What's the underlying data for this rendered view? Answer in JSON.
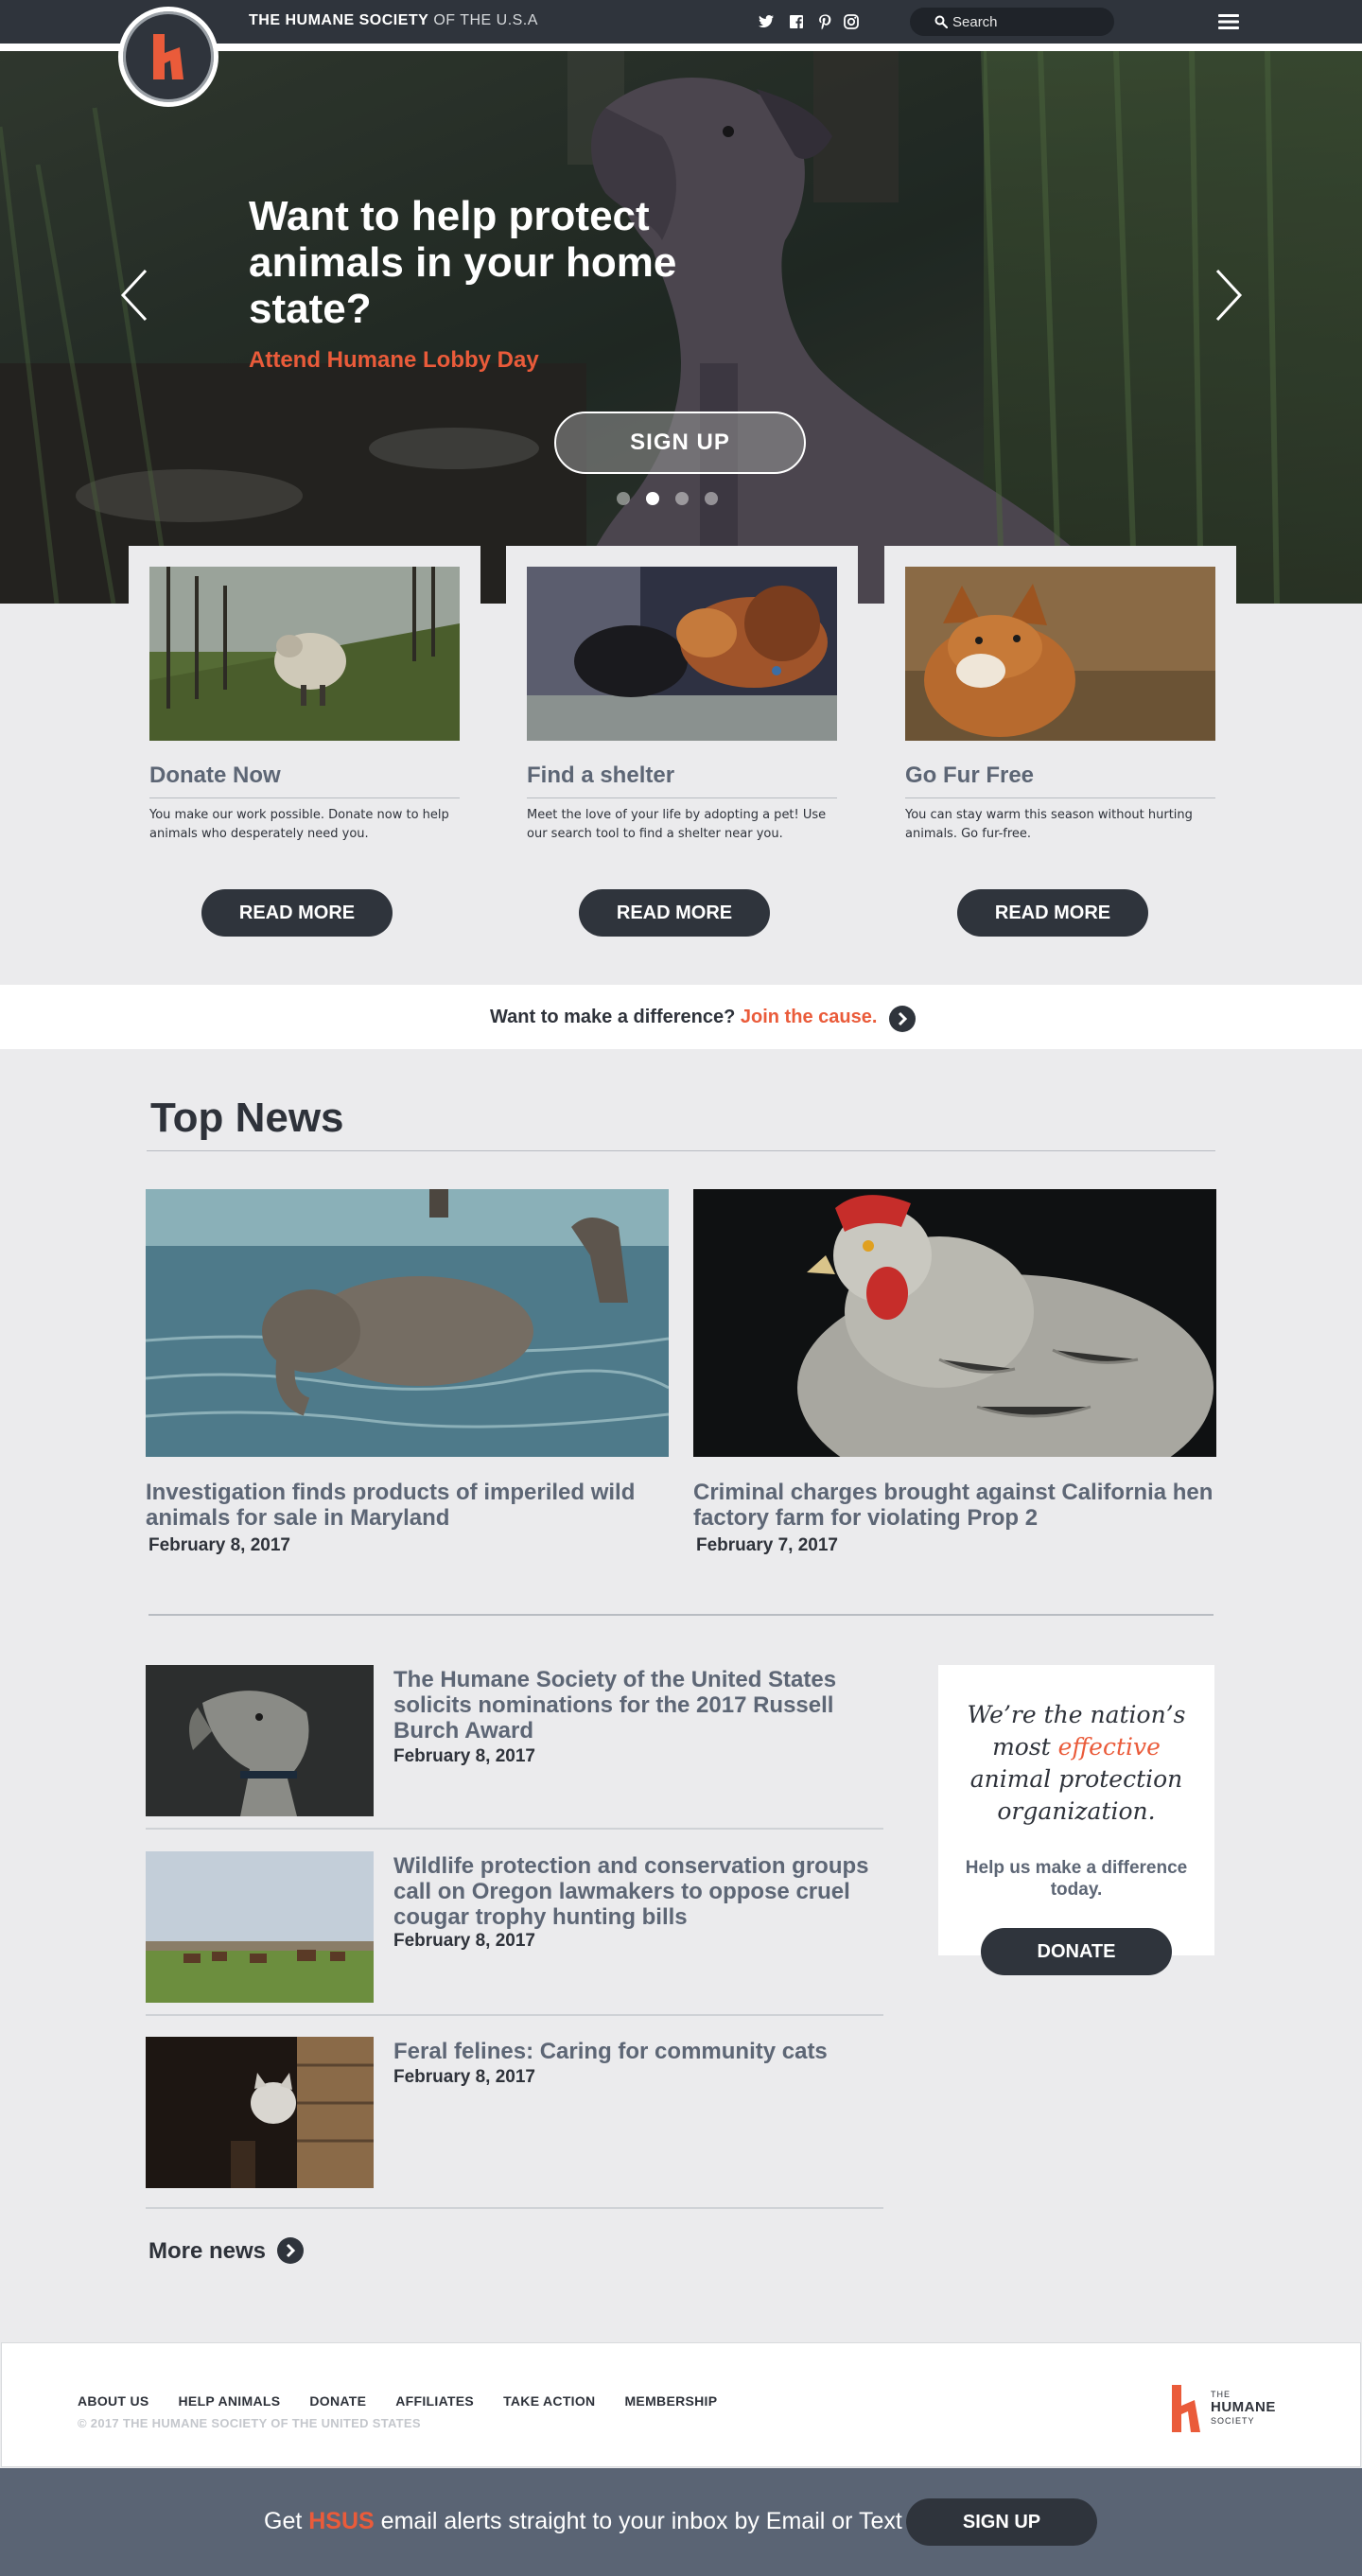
{
  "header": {
    "brand_the": "THE",
    "brand_bold": "HUMANE SOCIETY",
    "brand_rest": "OF THE U.S.A",
    "search_placeholder": "Search",
    "social_icons": [
      "twitter-icon",
      "facebook-icon",
      "pinterest-icon",
      "instagram-icon"
    ]
  },
  "hero": {
    "title": "Want to help protect animals in your home state?",
    "subtitle": "Attend Humane Lobby Day",
    "button": "SIGN UP",
    "slides": 4,
    "active_slide": 2
  },
  "cards": [
    {
      "title": "Donate Now",
      "text": "You make our work possible. Donate now to help animals who desperately need you.",
      "button": "READ MORE"
    },
    {
      "title": "Find a shelter",
      "text": "Meet the love of your life by adopting a pet! Use our search tool to find a shelter near you.",
      "button": "READ MORE"
    },
    {
      "title": "Go Fur Free",
      "text": "You can stay warm this season without hurting animals. Go fur-free.",
      "button": "READ MORE"
    }
  ],
  "join": {
    "text": "Want to make a difference?",
    "link": "Join the cause."
  },
  "top_news": {
    "heading": "Top News",
    "featured": [
      {
        "title": "Investigation finds products of imperiled wild animals for sale in Maryland",
        "date": "February 8, 2017"
      },
      {
        "title": "Criminal charges  brought against California hen factory farm for violating Prop 2",
        "date": "February 7, 2017"
      }
    ],
    "list": [
      {
        "title": "The Humane Society of the United States solicits nominations for the 2017 Russell Burch Award",
        "date": "February 8, 2017"
      },
      {
        "title": "Wildlife protection and conservation groups call on Oregon lawmakers to oppose cruel cougar trophy hunting bills",
        "date": "February 8, 2017"
      },
      {
        "title": "Feral felines: Caring for community cats",
        "date": "February 8, 2017"
      }
    ],
    "more": "More news"
  },
  "promo": {
    "line1": "We’re the nation’s",
    "line2_pre": "most ",
    "line2_hl": "effective",
    "line3": "animal protection",
    "line4": "organization.",
    "sub": "Help us make a difference today.",
    "button": "DONATE"
  },
  "footer": {
    "nav": [
      "ABOUT US",
      "HELP ANIMALS",
      "DONATE",
      "AFFILIATES",
      "TAKE ACTION",
      "MEMBERSHIP"
    ],
    "copyright": "© 2017 THE HUMANE SOCIETY OF THE UNITED STATES",
    "logo_top": "THE",
    "logo_main": "HUMANE",
    "logo_bottom": "SOCIETY"
  },
  "email_band": {
    "pre": "Get ",
    "hl": "HSUS",
    "post": " email alerts straight to your inbox by Email or Text",
    "button": "SIGN UP"
  },
  "colors": {
    "accent": "#ea5b3a",
    "dark": "#2f343c",
    "slate": "#5a6474"
  }
}
